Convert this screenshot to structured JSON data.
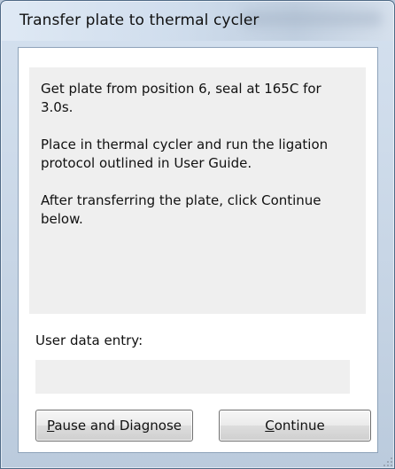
{
  "window": {
    "title": "Transfer plate to thermal cycler"
  },
  "message": {
    "lines": [
      "Get plate from position 6, seal at 165C for",
      "3.0s.",
      "Place in thermal cycler and run the ligation",
      "protocol outlined in User Guide.",
      "After transferring the plate, click Continue",
      "below."
    ]
  },
  "entry": {
    "label": "User data entry:",
    "value": ""
  },
  "buttons": {
    "pause": {
      "access_key": "P",
      "rest": "ause and Diagnose"
    },
    "continue": {
      "access_key": "C",
      "rest": "ontinue"
    }
  },
  "icons": {
    "resize_grip": "resize-grip-icon"
  },
  "colors": {
    "client_background": "#ffffff",
    "message_background": "#efefef",
    "input_background": "#efefef",
    "window_frame": "#b7c6d8"
  }
}
